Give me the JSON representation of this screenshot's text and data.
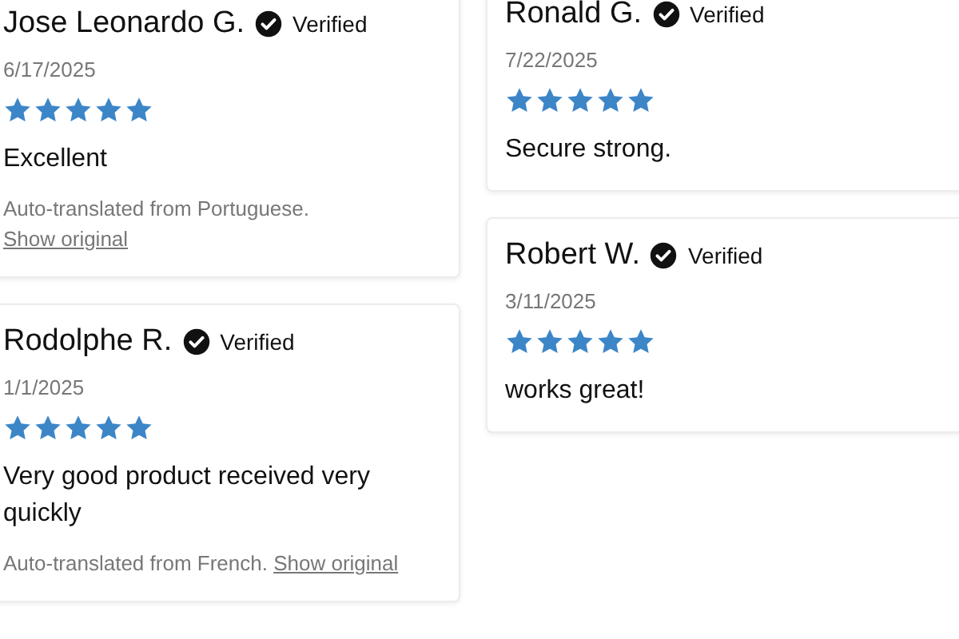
{
  "columns": [
    {
      "reviews": [
        {
          "name": "Jose Leonardo G.",
          "verified": true,
          "badge": "Verified",
          "date": "6/17/2025",
          "stars": 5,
          "text": "Excellent",
          "note": "Auto-translated from Portuguese.",
          "link": "Show original"
        },
        {
          "name": "Rodolphe R.",
          "verified": true,
          "badge": "Verified",
          "date": "1/1/2025",
          "stars": 5,
          "text": "Very good product received very quickly",
          "note": "Auto-translated from French.",
          "link": "Show original"
        }
      ]
    },
    {
      "reviews": [
        {
          "name": "Ronald G.",
          "verified": true,
          "badge": "Verified",
          "date": "7/22/2025",
          "stars": 5,
          "text": "Secure strong."
        },
        {
          "name": "Robert W.",
          "verified": true,
          "badge": "Verified",
          "date": "3/11/2025",
          "stars": 5,
          "text": "works great!"
        }
      ]
    }
  ]
}
